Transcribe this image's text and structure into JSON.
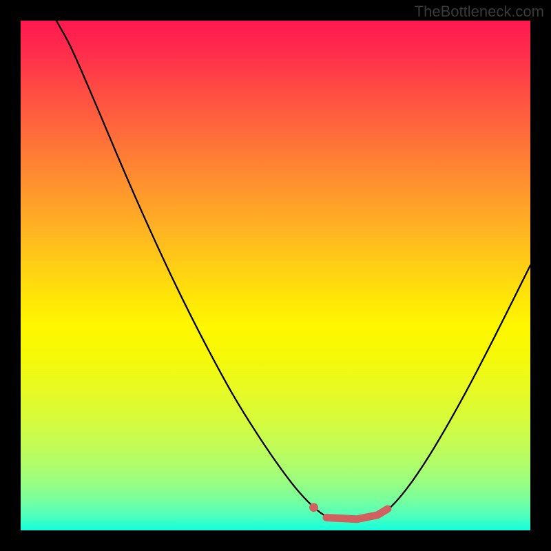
{
  "watermark": "TheBottleneck.com",
  "chart_data": {
    "type": "line",
    "title": "",
    "xlabel": "",
    "ylabel": "",
    "xlim": [
      0,
      1
    ],
    "ylim": [
      0,
      1
    ],
    "grid": false,
    "curve": {
      "description": "V-shaped bottleneck curve descending from top-left to a trough near x≈0.62 then rising to the right edge mid-height",
      "points": [
        {
          "x": 0.07,
          "y": 1.0
        },
        {
          "x": 0.095,
          "y": 0.955
        },
        {
          "x": 0.12,
          "y": 0.9
        },
        {
          "x": 0.15,
          "y": 0.83
        },
        {
          "x": 0.19,
          "y": 0.735
        },
        {
          "x": 0.24,
          "y": 0.62
        },
        {
          "x": 0.3,
          "y": 0.49
        },
        {
          "x": 0.36,
          "y": 0.37
        },
        {
          "x": 0.42,
          "y": 0.26
        },
        {
          "x": 0.48,
          "y": 0.165
        },
        {
          "x": 0.53,
          "y": 0.095
        },
        {
          "x": 0.565,
          "y": 0.055
        },
        {
          "x": 0.595,
          "y": 0.03
        },
        {
          "x": 0.62,
          "y": 0.02
        },
        {
          "x": 0.66,
          "y": 0.02
        },
        {
          "x": 0.695,
          "y": 0.027
        },
        {
          "x": 0.72,
          "y": 0.04
        },
        {
          "x": 0.76,
          "y": 0.085
        },
        {
          "x": 0.81,
          "y": 0.16
        },
        {
          "x": 0.87,
          "y": 0.265
        },
        {
          "x": 0.93,
          "y": 0.38
        },
        {
          "x": 1.0,
          "y": 0.52
        }
      ]
    },
    "highlight": {
      "color": "#d16160",
      "dot": {
        "x": 0.575,
        "y": 0.045
      },
      "segment": [
        {
          "x": 0.6,
          "y": 0.025
        },
        {
          "x": 0.66,
          "y": 0.022
        },
        {
          "x": 0.7,
          "y": 0.03
        },
        {
          "x": 0.72,
          "y": 0.042
        }
      ]
    },
    "background": {
      "type": "vertical-gradient",
      "stops": [
        {
          "pos": 0.0,
          "color": "#ff1850"
        },
        {
          "pos": 0.5,
          "color": "#ffd800"
        },
        {
          "pos": 1.0,
          "color": "#11ffdf"
        }
      ]
    }
  }
}
